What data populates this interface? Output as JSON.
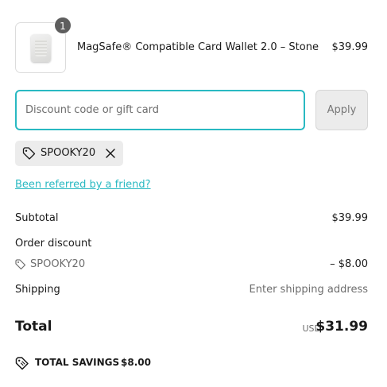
{
  "product": {
    "quantity": "1",
    "name": "MagSafe® Compatible Card Wallet 2.0 – Stone",
    "price": "$39.99"
  },
  "discount": {
    "placeholder": "Discount code or gift card",
    "apply_label": "Apply",
    "applied_code": "SPOOKY20"
  },
  "referral_link": "Been referred by a friend?",
  "summary": {
    "subtotal_label": "Subtotal",
    "subtotal_value": "$39.99",
    "order_discount_label": "Order discount",
    "discount_code": "SPOOKY20",
    "discount_value": "– $8.00",
    "shipping_label": "Shipping",
    "shipping_value": "Enter shipping address",
    "total_label": "Total",
    "currency": "USD",
    "total_value": "$31.99",
    "savings_label": "TOTAL SAVINGS",
    "savings_value": "$8.00"
  },
  "colors": {
    "accent": "#29b9c2",
    "chip_bg": "#ececec",
    "muted_text": "#6d6d6d"
  },
  "icons": [
    "tag-icon",
    "close-icon",
    "savings-tag-icon"
  ]
}
